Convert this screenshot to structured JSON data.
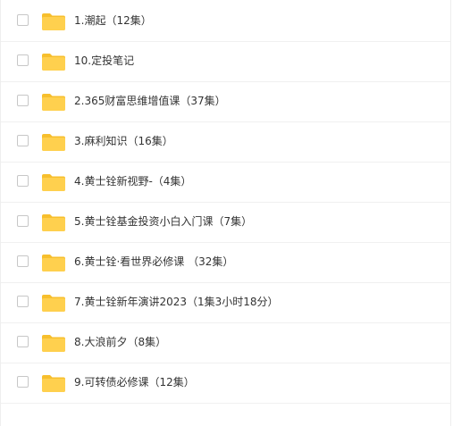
{
  "files": {
    "items": [
      {
        "name": "1.潮起（12集）"
      },
      {
        "name": "10.定投笔记"
      },
      {
        "name": "2.365财富思维增值课（37集）"
      },
      {
        "name": "3.麻利知识（16集）"
      },
      {
        "name": "4.黄士铨新视野-（4集）"
      },
      {
        "name": "5.黄士铨基金投资小白入门课（7集）"
      },
      {
        "name": "6.黄士铨·看世界必修课 （32集）"
      },
      {
        "name": "7.黄士铨新年演讲2023（1集3小时18分）"
      },
      {
        "name": "8.大浪前夕（8集）"
      },
      {
        "name": "9.可转债必修课（12集）"
      }
    ]
  },
  "icons": {
    "folder": "folder-icon"
  },
  "colors": {
    "folder_fill": "#FFD04E",
    "folder_tab": "#F7BF2D",
    "text": "#333333",
    "checkbox_border": "#C7C7C7",
    "divider": "#F0F0F0"
  }
}
